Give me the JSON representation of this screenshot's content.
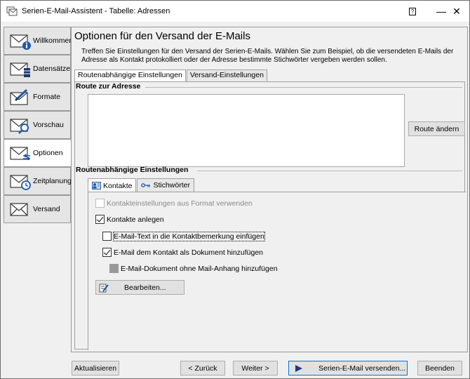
{
  "window": {
    "title": "Serien-E-Mail-Assistent - Tabelle: Adressen",
    "help_glyph": "?",
    "minimize_glyph": "—",
    "close_glyph": "✕"
  },
  "sidebar": {
    "items": [
      {
        "label": "Willkommen",
        "icon": "envelope-info-icon"
      },
      {
        "label": "Datensätze",
        "icon": "envelope-table-icon"
      },
      {
        "label": "Formate",
        "icon": "envelope-pen-icon"
      },
      {
        "label": "Vorschau",
        "icon": "envelope-magnifier-icon"
      },
      {
        "label": "Optionen",
        "icon": "envelope-options-icon"
      },
      {
        "label": "Zeitplanung",
        "icon": "envelope-clock-icon"
      },
      {
        "label": "Versand",
        "icon": "envelope-send-icon"
      }
    ],
    "active_index": 4
  },
  "main": {
    "title": "Optionen für den Versand der E-Mails",
    "description": "Treffen Sie Einstellungen für den Versand der Serien-E-Mails. Wählen Sie zum Beispiel, ob die versendeten E-Mails der Adresse als Kontakt protokolliert oder der Adresse bestimmte Stichwörter vergeben werden sollen.",
    "tabs": [
      {
        "label": "Routenabhängige Einstellungen",
        "active": true
      },
      {
        "label": "Versand-Einstellungen",
        "active": false
      }
    ],
    "route_group_title": "Route zur Adresse",
    "route_button": "Route ändern",
    "route_settings_title": "Routenabhängige Einstellungen",
    "inner_tabs": [
      {
        "label": "Kontakte",
        "active": true,
        "icon": "contacts-icon"
      },
      {
        "label": "Stichwörter",
        "active": false,
        "icon": "key-icon"
      }
    ],
    "options": [
      {
        "label": "Kontakteinstellungen aus Format verwenden",
        "checked": false,
        "enabled": false
      },
      {
        "label": "Kontakte anlegen",
        "checked": true,
        "enabled": true
      },
      {
        "label": "E-Mail-Text in die Kontaktbemerkung einfügen",
        "checked": false,
        "enabled": true
      },
      {
        "label": "E-Mail dem Kontakt als Dokument hinzufügen",
        "checked": true,
        "enabled": true
      },
      {
        "label": "E-Mail-Dokument ohne Mail-Anhang hinzufügen",
        "checked": false,
        "enabled": true,
        "indeterminate": true
      }
    ],
    "edit_button": "Bearbeiten..."
  },
  "footer": {
    "refresh": "Aktualisieren",
    "back": "< Zurück",
    "next": "Weiter >",
    "send": "Serien-E-Mail versenden...",
    "finish": "Beenden"
  }
}
